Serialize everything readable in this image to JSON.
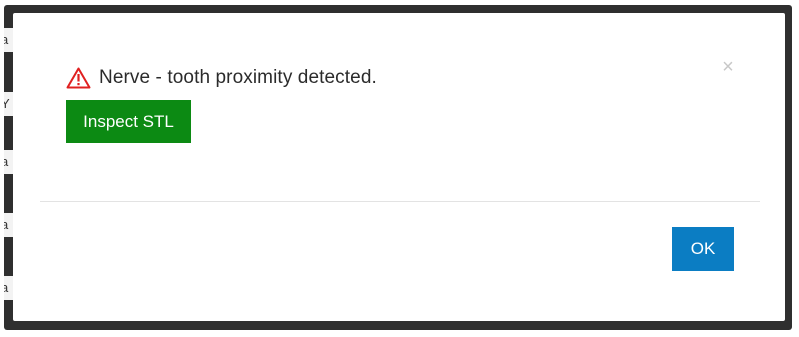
{
  "dialog": {
    "message": "Nerve - tooth proximity detected.",
    "warning_icon": "warning-triangle-icon",
    "close_glyph": "×",
    "inspect_button_label": "Inspect STL",
    "ok_button_label": "OK"
  },
  "background": {
    "slivers": [
      "a",
      "Y",
      "a",
      "a",
      "a"
    ]
  },
  "colors": {
    "warning": "#e02020",
    "inspect_button": "#0c8a13",
    "ok_button": "#0b7dc3"
  }
}
